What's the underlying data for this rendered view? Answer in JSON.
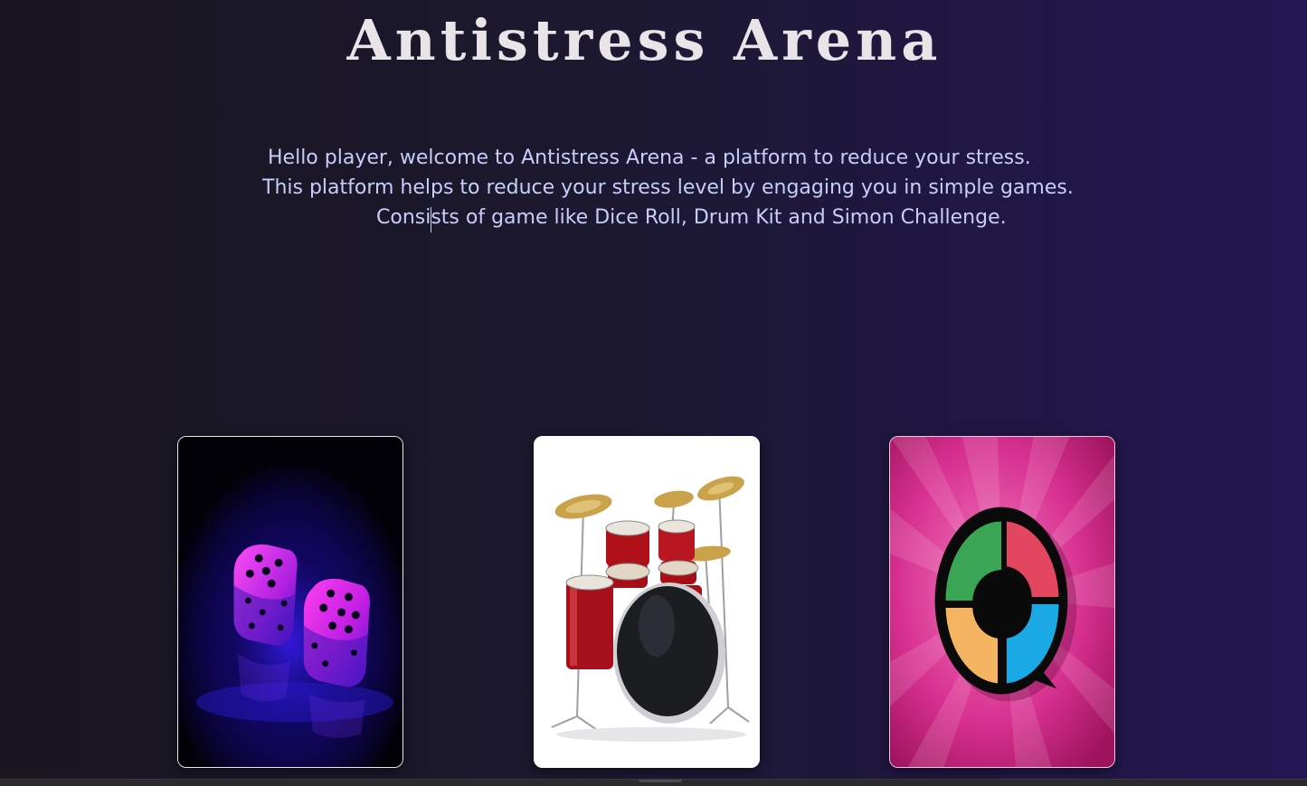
{
  "page": {
    "title": "Antistress Arena",
    "intro_lines": [
      "Hello player, welcome to Antistress Arena - a platform to reduce your stress.",
      "This platform helps to reduce your stress level by engaging you in simple games.",
      "Consists of game like Dice Roll, Drum Kit and Simon Challenge."
    ]
  },
  "cards": [
    {
      "name": "dice-roll",
      "icon": "dice-icon"
    },
    {
      "name": "drum-kit",
      "icon": "drum-kit-icon"
    },
    {
      "name": "simon-challenge",
      "icon": "simon-icon"
    }
  ],
  "colors": {
    "title": "#e8e4e8",
    "intro_text": "#c8cdfa",
    "background_start": "#19161f",
    "background_end": "#231653",
    "simon_green": "#3aa655",
    "simon_red": "#e3475f",
    "simon_yellow": "#f4b461",
    "simon_blue": "#1ba9e6"
  }
}
